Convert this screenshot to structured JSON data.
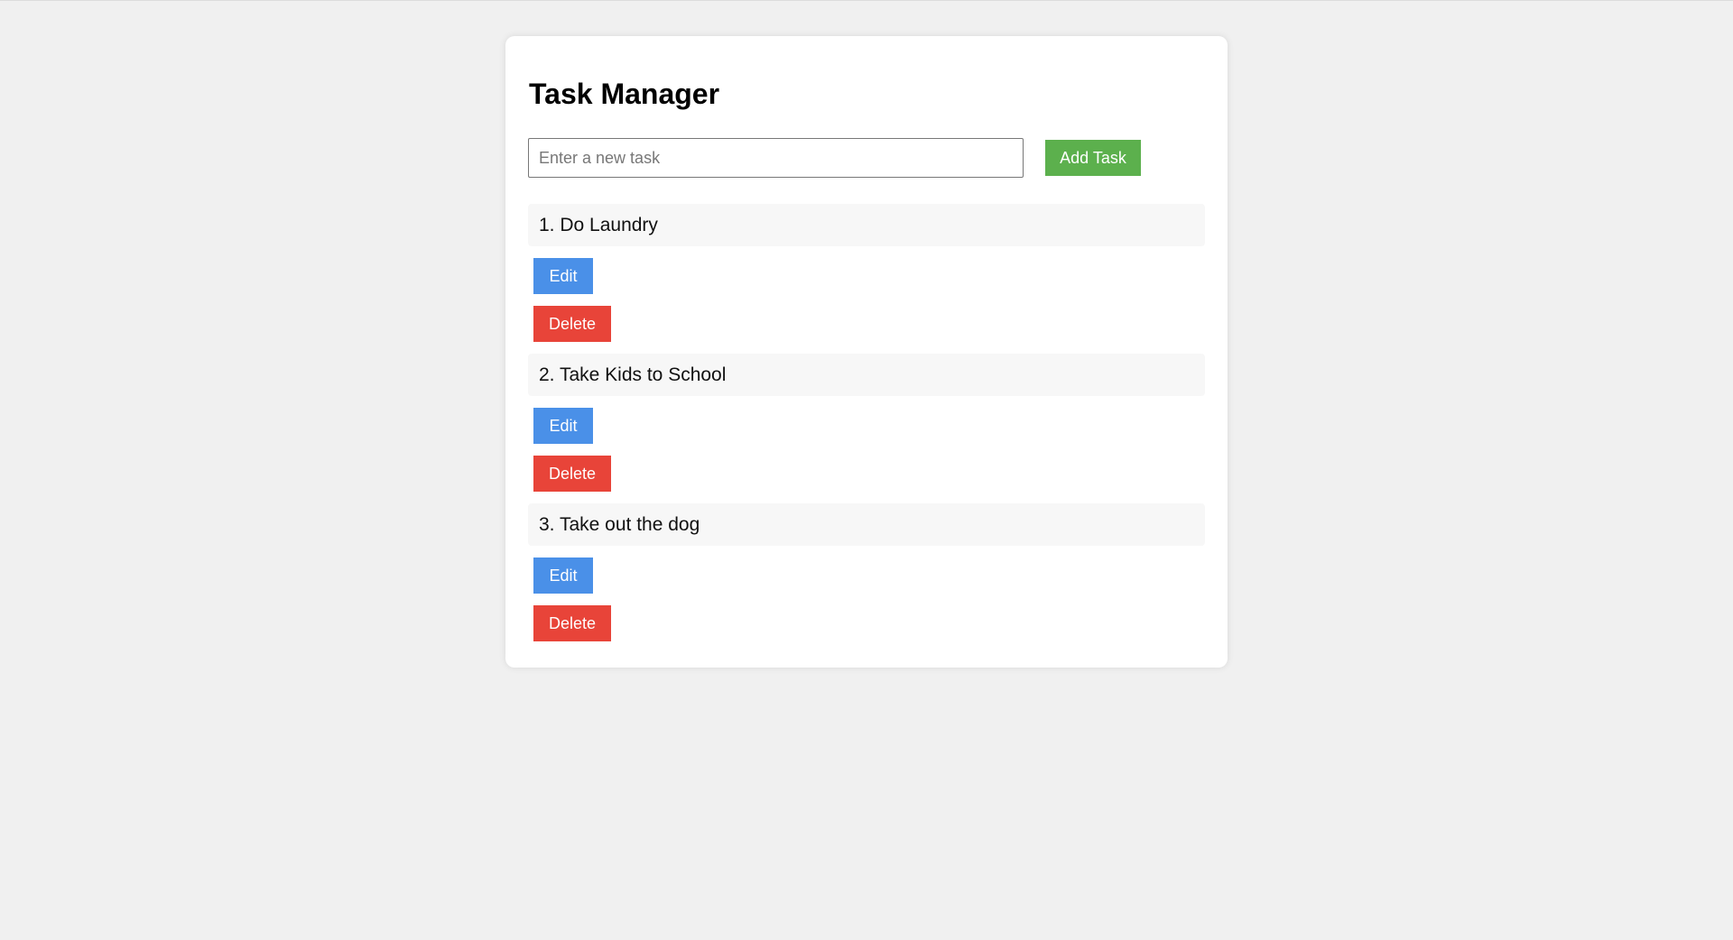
{
  "app": {
    "title": "Task Manager"
  },
  "new_task": {
    "placeholder": "Enter a new task",
    "value": "",
    "add_label": "Add Task"
  },
  "tasks": [
    {
      "label": "1. Do Laundry",
      "edit_label": "Edit",
      "delete_label": "Delete"
    },
    {
      "label": "2. Take Kids to School",
      "edit_label": "Edit",
      "delete_label": "Delete"
    },
    {
      "label": "3. Take out the dog",
      "edit_label": "Edit",
      "delete_label": "Delete"
    }
  ],
  "colors": {
    "page_background": "#f0f0f0",
    "card_background": "#ffffff",
    "add_button": "#5cb04d",
    "edit_button": "#4a90e8",
    "delete_button": "#e84439",
    "task_row_background": "#f7f7f7"
  }
}
